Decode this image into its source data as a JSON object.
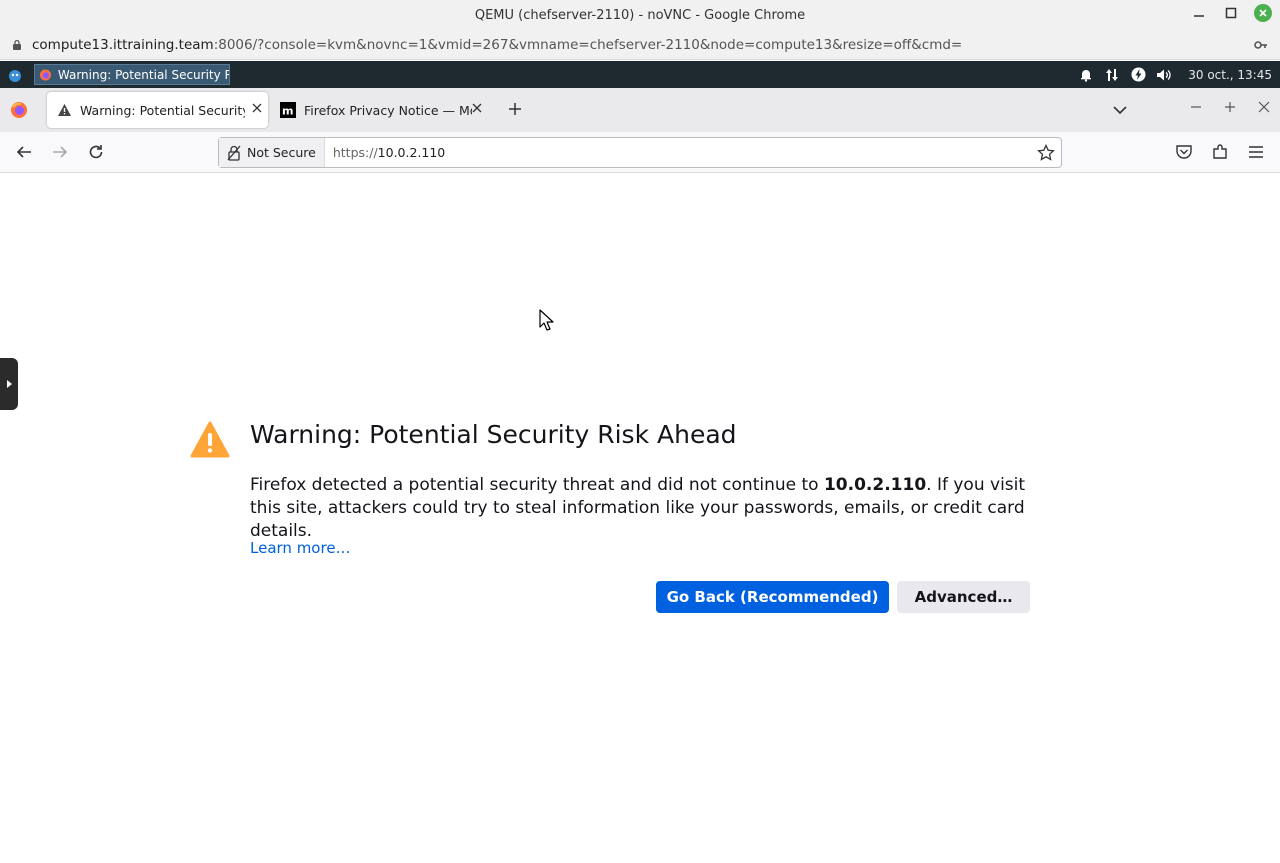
{
  "chrome": {
    "title": "QEMU (chefserver-2110) - noVNC - Google Chrome",
    "url_host": "compute13.ittraining.team",
    "url_rest": ":8006/?console=kvm&novnc=1&vmid=267&vmname=chefserver-2110&node=compute13&resize=off&cmd="
  },
  "taskbar": {
    "task_label": "Warning: Potential Security R...",
    "clock": "30 oct., 13:45"
  },
  "firefox": {
    "tabs": [
      {
        "label": "Warning: Potential Security Ri"
      },
      {
        "label": "Firefox Privacy Notice — Mozi"
      }
    ],
    "not_secure_label": "Not Secure",
    "url_scheme": "https://",
    "url_host": "10.0.2.110"
  },
  "page": {
    "title": "Warning: Potential Security Risk Ahead",
    "body_prefix": "Firefox detected a potential security threat and did not continue to ",
    "body_host": "10.0.2.110",
    "body_suffix": ". If you visit this site, attackers could try to steal information like your passwords, emails, or credit card details.",
    "learn_more": "Learn more…",
    "go_back": "Go Back (Recommended)",
    "advanced": "Advanced…"
  },
  "colors": {
    "primary_button": "#0061e0",
    "warning_icon": "#ffa436",
    "link": "#0061e0"
  }
}
